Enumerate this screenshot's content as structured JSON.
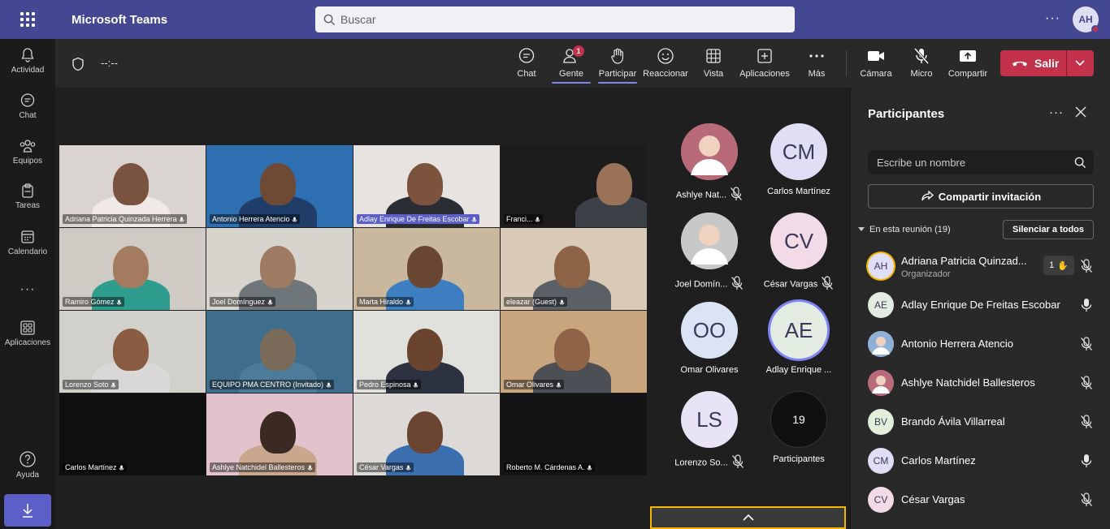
{
  "topbar": {
    "app_title": "Microsoft Teams",
    "search_placeholder": "Buscar",
    "user_initials": "AH"
  },
  "rail": {
    "items": [
      {
        "label": "Actividad",
        "icon": "bell-icon"
      },
      {
        "label": "Chat",
        "icon": "chat-icon"
      },
      {
        "label": "Equipos",
        "icon": "teams-icon"
      },
      {
        "label": "Tareas",
        "icon": "tasks-icon"
      },
      {
        "label": "Calendario",
        "icon": "calendar-icon"
      },
      {
        "label": "Aplicaciones",
        "icon": "apps-icon"
      },
      {
        "label": "Ayuda",
        "icon": "help-icon"
      }
    ],
    "more": "···"
  },
  "meeting": {
    "timer": "--:--",
    "toolbar": {
      "chat": "Chat",
      "people": "Gente",
      "people_badge": "1",
      "raise": "Participar",
      "react": "Reaccionar",
      "view": "Vista",
      "apps": "Aplicaciones",
      "more": "Más",
      "camera": "Cámara",
      "mic": "Micro",
      "share": "Compartir",
      "leave": "Salir"
    }
  },
  "gallery": [
    {
      "name": "Adriana Patricia Quinzada Herrera",
      "bg": "#d9d4cf",
      "shirt": "#efeae6",
      "skin": "#7a5240"
    },
    {
      "name": "Antonio Herrera Atencio",
      "bg": "#2d6fb0",
      "shirt": "#1f3f6a",
      "skin": "#6e4a35"
    },
    {
      "name": "Adlay Enrique De Freitas Escobar",
      "bg": "#e6e3e0",
      "shirt": "#2a2d33",
      "skin": "#7c533d",
      "highlight": true
    },
    {
      "name": "Franci...",
      "bg": "#1c1c1c",
      "shirt": "#3c4148",
      "skin": "#9a7258"
    },
    {
      "name": "Ramiro Gómez",
      "bg": "#cfcac4",
      "shirt": "#2f9d8d",
      "skin": "#a57b5f"
    },
    {
      "name": "Joel Domínguez",
      "bg": "#d7d3cd",
      "shirt": "#6f767a",
      "skin": "#a07b63"
    },
    {
      "name": "Marta Hiraldo",
      "bg": "#c9b79e",
      "shirt": "#3d7ec0",
      "skin": "#6a4733"
    },
    {
      "name": "eleazar (Guest)",
      "bg": "#d8cab6",
      "shirt": "#5a6066",
      "skin": "#8e6447"
    },
    {
      "name": "Lorenzo Soto",
      "bg": "#d2d0cb",
      "shirt": "#d9d8d6",
      "skin": "#8a5d42"
    },
    {
      "name": "EQUIPO PMA CENTRO (Invitado)",
      "bg": "#3f6e8c",
      "shirt": "#4d7c9a",
      "skin": "#7a6a5a"
    },
    {
      "name": "Pedro Espinosa",
      "bg": "#e0e0dc",
      "shirt": "#2d3240",
      "skin": "#6b442f"
    },
    {
      "name": "Omar Olivares",
      "bg": "#c9a57d",
      "shirt": "#4d4f56",
      "skin": "#8f6446"
    },
    {
      "name": "Carlos Martínez",
      "bg": "#101010",
      "shirt": "#101010",
      "skin": "#101010"
    },
    {
      "name": "Ashlye Natchidel Ballesteros",
      "bg": "#e2c3cb",
      "shirt": "#c9a78f",
      "skin": "#3a2a22"
    },
    {
      "name": "César Vargas",
      "bg": "#dcd9d6",
      "shirt": "#3b6fb0",
      "skin": "#6b4531"
    },
    {
      "name": "Roberto M. Cárdenas A.",
      "bg": "#141414",
      "shirt": "#141414",
      "skin": "#141414"
    }
  ],
  "side_avatars": [
    {
      "label": "Ashlye Nat...",
      "initials": "",
      "color": "#b86a78",
      "muted": true,
      "photo": true
    },
    {
      "label": "Carlos Martínez",
      "initials": "CM",
      "color": "#dfdef5",
      "muted": false
    },
    {
      "label": "Joel Domín...",
      "initials": "",
      "color": "#c8c8c8",
      "muted": true,
      "photo": true
    },
    {
      "label": "César Vargas",
      "initials": "CV",
      "color": "#f2dbe6",
      "muted": true
    },
    {
      "label": "Omar Olivares",
      "initials": "OO",
      "color": "#dbe4f5",
      "muted": false
    },
    {
      "label": "Adlay Enrique ...",
      "initials": "AE",
      "color": "#e3ece0",
      "muted": false,
      "speaking": true
    },
    {
      "label": "Lorenzo So...",
      "initials": "LS",
      "color": "#e8e4f5",
      "muted": true
    },
    {
      "label": "Participantes",
      "initials": "19",
      "color": "#101010",
      "muted": false
    }
  ],
  "panel": {
    "title": "Participantes",
    "search_placeholder": "Escribe un nombre",
    "share_label": "Compartir invitación",
    "section": "En esta reunión (19)",
    "mute_all": "Silenciar a todos",
    "people": [
      {
        "name": "Adriana Patricia Quinzad...",
        "initials": "AH",
        "role": "Organizador",
        "color": "#dfdef5",
        "mic": "muted",
        "hand": "1"
      },
      {
        "name": "Adlay Enrique De Freitas Escobar",
        "initials": "AE",
        "color": "#e3ece0",
        "mic": "on"
      },
      {
        "name": "Antonio Herrera Atencio",
        "initials": "",
        "color": "#8fb1d8",
        "mic": "muted"
      },
      {
        "name": "Ashlye Natchidel Ballesteros",
        "initials": "",
        "color": "#b86a78",
        "mic": "muted"
      },
      {
        "name": "Brando Ávila Villarreal",
        "initials": "BV",
        "color": "#e2f0d9",
        "mic": "muted"
      },
      {
        "name": "Carlos Martínez",
        "initials": "CM",
        "color": "#dfdef5",
        "mic": "on"
      },
      {
        "name": "César Vargas",
        "initials": "CV",
        "color": "#f2dbe6",
        "mic": "muted"
      }
    ]
  },
  "colors": {
    "brand": "#444791",
    "accent": "#5b5fc7",
    "leave": "#c4314b",
    "spotlight": "#f5b800"
  }
}
